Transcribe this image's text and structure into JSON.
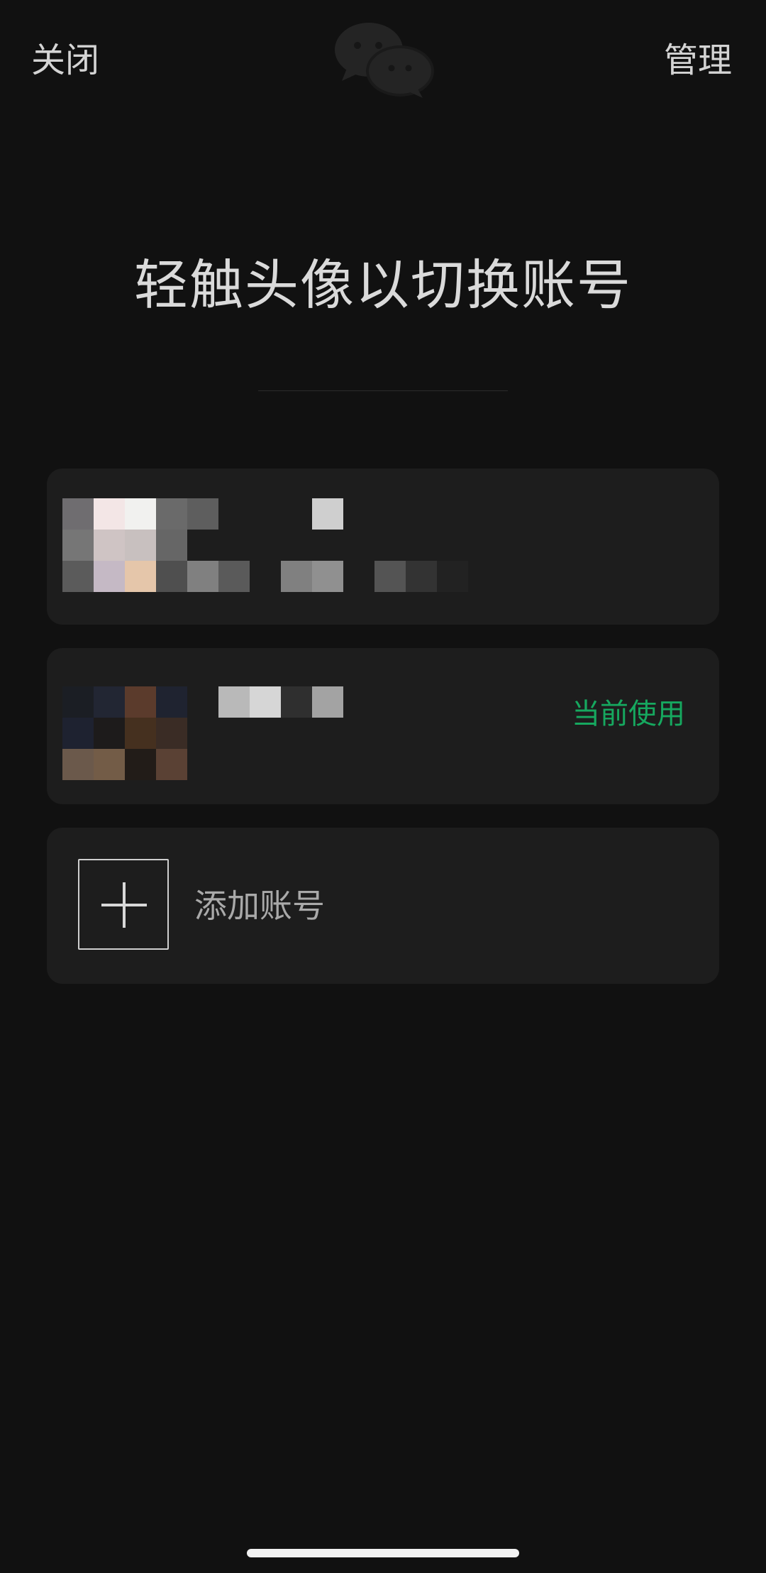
{
  "header": {
    "close_label": "关闭",
    "manage_label": "管理",
    "logo_icon": "wechat-logo-icon"
  },
  "main": {
    "title": "轻触头像以切换账号",
    "accounts": [
      {
        "status_label": "",
        "avatar": "pixelated-avatar",
        "name": "pixelated-name"
      },
      {
        "status_label": "当前使用",
        "avatar": "pixelated-avatar",
        "name": "pixelated-name"
      }
    ],
    "add_account": {
      "label": "添加账号",
      "icon": "plus-icon"
    }
  },
  "colors": {
    "background": "#111111",
    "card": "#1d1d1d",
    "text": "#d6d6d6",
    "accent_green": "#16a85f",
    "muted_text": "#a9a9a9"
  }
}
